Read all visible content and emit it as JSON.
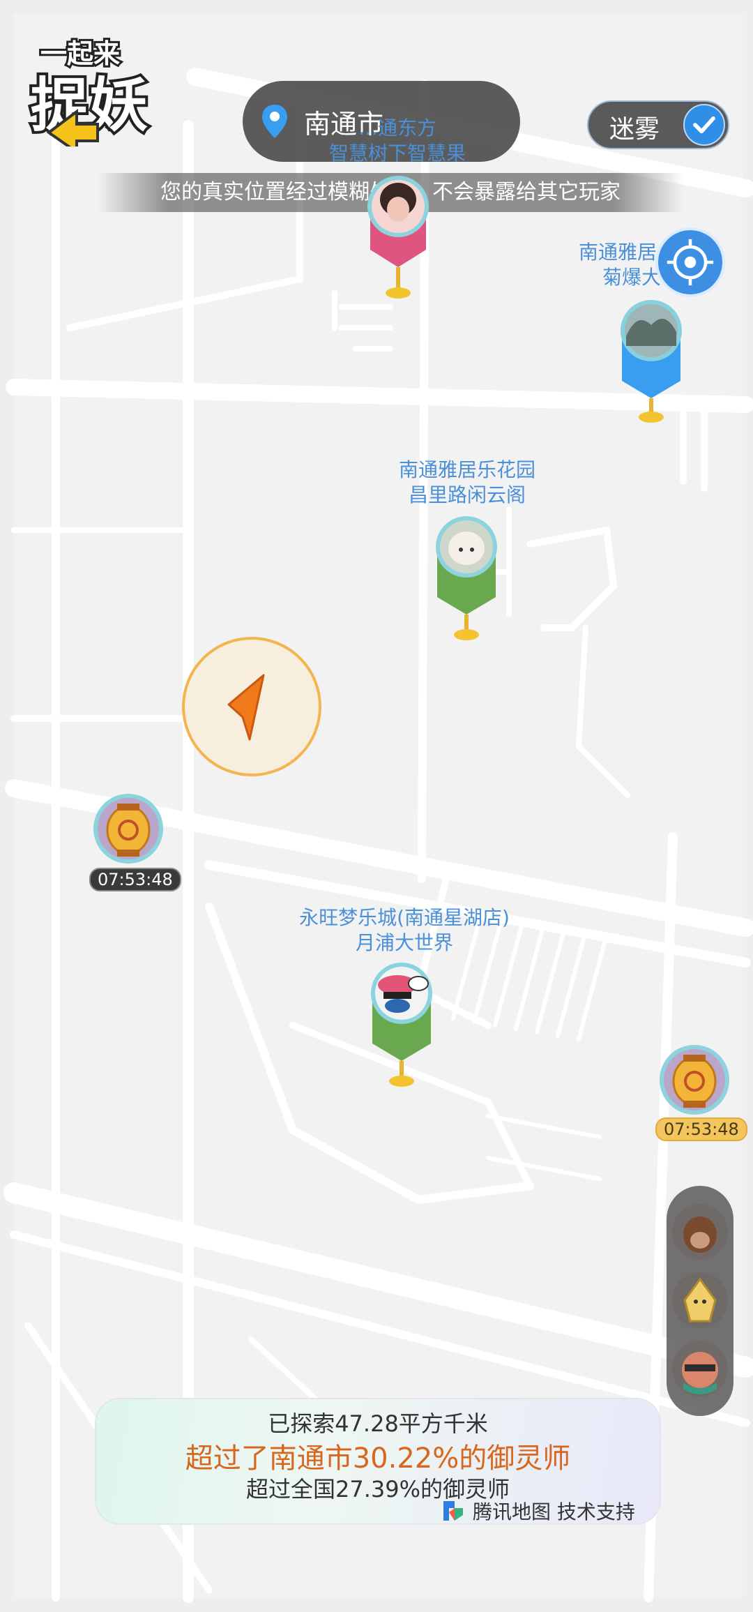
{
  "logo": {
    "text": "一起来捉妖"
  },
  "city": {
    "name": "南通市"
  },
  "fog_toggle": {
    "label": "迷雾",
    "checked": true
  },
  "notice": "您的真实位置经过模糊处理，不会暴露给其它玩家",
  "map_labels": [
    {
      "line1": "…通东方",
      "line2": "智慧树下智慧果"
    },
    {
      "line1": "南通雅居",
      "line2": "菊爆大"
    },
    {
      "line1": "南通雅居乐花园",
      "line2": "昌里路闲云阁"
    },
    {
      "line1": "永旺梦乐城(南通星湖店)",
      "line2": "月浦大世界"
    }
  ],
  "timers": [
    {
      "text": "07:53:48"
    },
    {
      "text": "07:53:48"
    }
  ],
  "stats": {
    "explored": "已探索47.28平方千米",
    "city_rank": "超过了南通市30.22%的御灵师",
    "national_rank": "超过全国27.39%的御灵师"
  },
  "attribution": "腾讯地图 技术支持",
  "colors": {
    "accent_blue": "#3d8fe3",
    "marker_pink": "#e05580",
    "marker_blue": "#3a9ef0",
    "marker_green": "#6aa84f",
    "highlight_orange": "#d8661e"
  }
}
